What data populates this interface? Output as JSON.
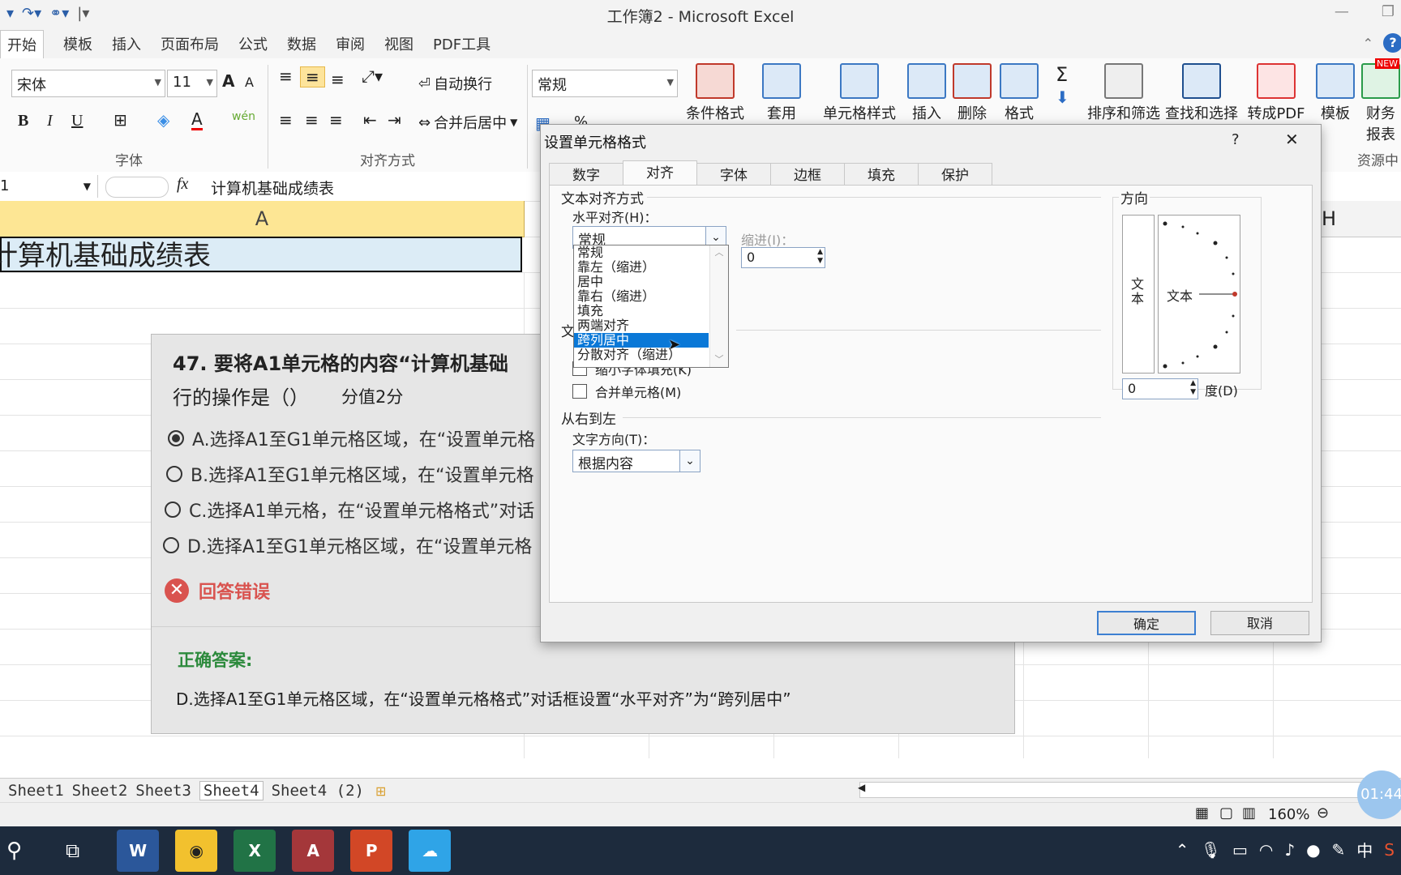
{
  "window": {
    "title": "工作簿2 - Microsoft Excel"
  },
  "ribbon_tabs": [
    "开始",
    "模板",
    "插入",
    "页面布局",
    "公式",
    "数据",
    "审阅",
    "视图",
    "PDF工具"
  ],
  "font": {
    "name": "宋体",
    "size": "11",
    "grow": "A",
    "shrink": "A",
    "bold": "B",
    "italic": "I",
    "underline": "U",
    "color_letter": "A",
    "phonetic": "wén",
    "group_label": "字体"
  },
  "alignment": {
    "wrap_text": "自动换行",
    "merge_center": "合并后居中",
    "group_label": "对齐方式"
  },
  "number": {
    "format": "常规",
    "percent": "%"
  },
  "ribbon_buttons": {
    "conditional": "条件格式",
    "table": "套用",
    "cell_style": "单元格样式",
    "insert": "插入",
    "delete": "删除",
    "format": "格式",
    "sort_filter": "排序和筛选",
    "find_select": "查找和选择",
    "to_pdf": "转成PDF",
    "template": "模板",
    "finance": "财务",
    "report": "报表",
    "resource_label": "资源中",
    "new_badge": "NEW",
    "sigma": "Σ"
  },
  "formula_bar": {
    "name_box": "1",
    "fx": "fx",
    "content": "计算机基础成绩表"
  },
  "grid": {
    "col_a": "A",
    "col_h": "H",
    "a1_text": "计算机基础成绩表"
  },
  "photo": {
    "question_line1": "47. 要将A1单元格的内容“计算机基础",
    "question_line2": "行的操作是（）",
    "score": "分值2分",
    "options": [
      "A.选择A1至G1单元格区域，在“设置单元格",
      "B.选择A1至G1单元格区域，在“设置单元格",
      "C.选择A1单元格，在“设置单元格格式”对话",
      "D.选择A1至G1单元格区域，在“设置单元格"
    ],
    "wrong": "回答错误",
    "answer_label": "正确答案:",
    "answer_text": "D.选择A1至G1单元格区域，在“设置单元格格式”对话框设置“水平对齐”为“跨列居中”"
  },
  "dialog": {
    "title": "设置单元格格式",
    "help": "?",
    "close": "✕",
    "tabs": [
      "数字",
      "对齐",
      "字体",
      "边框",
      "填充",
      "保护"
    ],
    "text_align_section": "文本对齐方式",
    "horizontal_label": "水平对齐(H)：",
    "horizontal_value": "常规",
    "indent_label": "缩进(I)：",
    "indent_value": "0",
    "options": [
      "常规",
      "靠左（缩进）",
      "居中",
      "靠右（缩进）",
      "填充",
      "两端对齐",
      "跨列居中",
      "分散对齐（缩进）"
    ],
    "selected_option": "跨列居中",
    "partial_section": "文",
    "shrink_label": "缩小字体填充(K)",
    "merge_label": "合并单元格(M)",
    "rtl_section": "从右到左",
    "text_dir_label": "文字方向(T)：",
    "text_dir_value": "根据内容",
    "orientation_section": "方向",
    "vertical_text": "文本",
    "orientation_text": "文本",
    "degrees_value": "0",
    "degrees_label": "度(D)",
    "ok": "确定",
    "cancel": "取消"
  },
  "sheets": [
    "Sheet1",
    "Sheet2",
    "Sheet3",
    "Sheet4",
    "Sheet4 (2)"
  ],
  "active_sheet": "Sheet4",
  "status": {
    "zoom": "160%",
    "timer": "01:44"
  },
  "taskbar": {
    "ime": "中",
    "word": "W",
    "excel": "X",
    "access": "A",
    "ppt": "P"
  }
}
